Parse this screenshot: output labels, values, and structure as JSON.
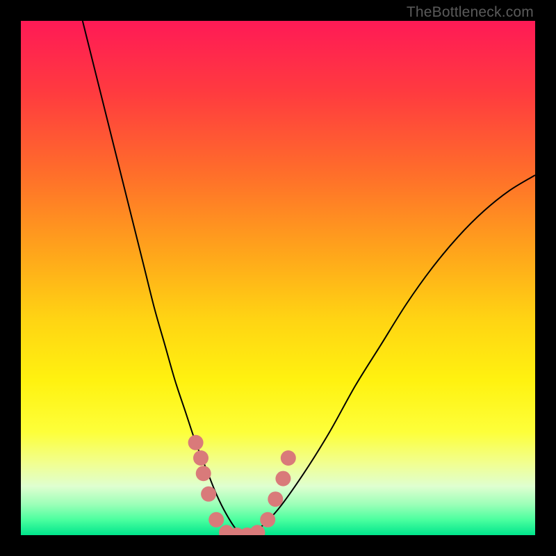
{
  "watermark": "TheBottleneck.com",
  "chart_data": {
    "type": "line",
    "title": "",
    "xlabel": "",
    "ylabel": "",
    "xlim": [
      0,
      100
    ],
    "ylim": [
      0,
      100
    ],
    "gradient_stops": [
      {
        "offset": 0.0,
        "color": "#ff1a56"
      },
      {
        "offset": 0.14,
        "color": "#ff3b3f"
      },
      {
        "offset": 0.3,
        "color": "#ff6f2a"
      },
      {
        "offset": 0.45,
        "color": "#ffa51b"
      },
      {
        "offset": 0.58,
        "color": "#ffd413"
      },
      {
        "offset": 0.7,
        "color": "#fff210"
      },
      {
        "offset": 0.8,
        "color": "#fdff3a"
      },
      {
        "offset": 0.86,
        "color": "#f1ff90"
      },
      {
        "offset": 0.905,
        "color": "#dfffd0"
      },
      {
        "offset": 0.94,
        "color": "#9cffb8"
      },
      {
        "offset": 0.97,
        "color": "#4bff9f"
      },
      {
        "offset": 1.0,
        "color": "#00e58c"
      }
    ],
    "series": [
      {
        "name": "bottleneck-curve",
        "x": [
          12,
          14,
          16,
          18,
          20,
          22,
          24,
          26,
          28,
          30,
          32,
          34,
          36,
          38,
          40,
          42,
          44,
          46,
          50,
          55,
          60,
          65,
          70,
          75,
          80,
          85,
          90,
          95,
          100
        ],
        "values": [
          100,
          92,
          84,
          76,
          68,
          60,
          52,
          44,
          37,
          30,
          24,
          18,
          13,
          8,
          4,
          1,
          0,
          1,
          5,
          12,
          20,
          29,
          37,
          45,
          52,
          58,
          63,
          67,
          70
        ]
      }
    ],
    "marker_points": {
      "name": "highlight-markers",
      "color": "#d97a7a",
      "points": [
        {
          "x": 34.0,
          "y": 18
        },
        {
          "x": 35.0,
          "y": 15
        },
        {
          "x": 35.5,
          "y": 12
        },
        {
          "x": 36.5,
          "y": 8
        },
        {
          "x": 38.0,
          "y": 3
        },
        {
          "x": 40.0,
          "y": 0.5
        },
        {
          "x": 42.0,
          "y": 0
        },
        {
          "x": 44.0,
          "y": 0
        },
        {
          "x": 46.0,
          "y": 0.5
        },
        {
          "x": 48.0,
          "y": 3
        },
        {
          "x": 49.5,
          "y": 7
        },
        {
          "x": 51.0,
          "y": 11
        },
        {
          "x": 52.0,
          "y": 15
        }
      ]
    }
  }
}
